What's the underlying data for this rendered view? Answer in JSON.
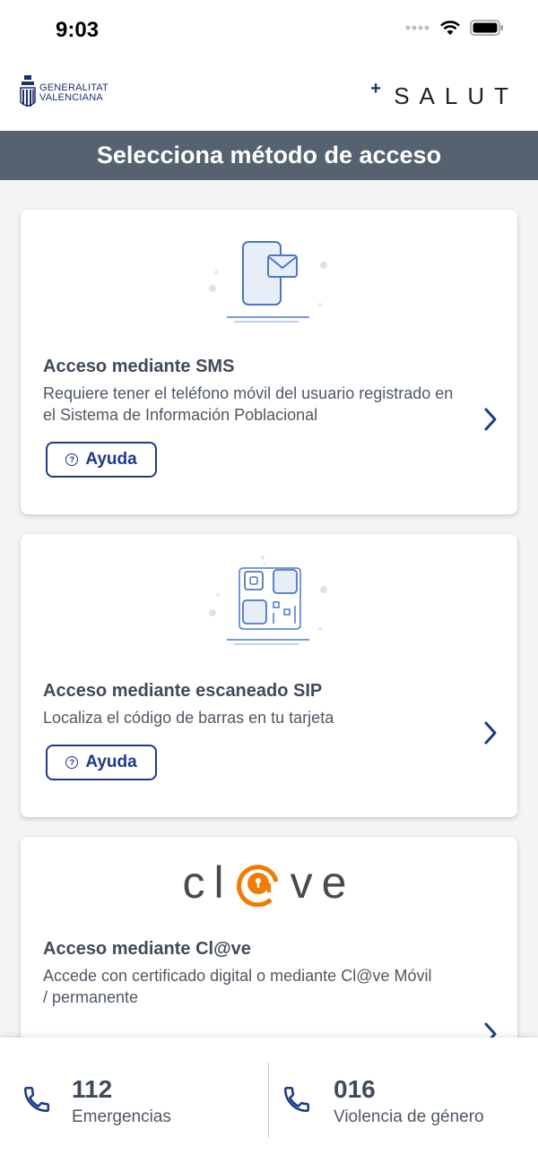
{
  "status_bar": {
    "time": "9:03"
  },
  "header": {
    "gva_logo_line1": "GENERALITAT",
    "gva_logo_line2": "VALENCIANA",
    "salut_logo": "SALUT"
  },
  "page_title": "Selecciona método de acceso",
  "methods": [
    {
      "title": "Acceso mediante SMS",
      "description": "Requiere tener el teléfono móvil del usuario registrado en el Sistema de Información Poblacional",
      "help_label": "Ayuda",
      "icon": "phone-message-icon"
    },
    {
      "title": "Acceso mediante escaneado SIP",
      "description": "Localiza el código de barras en tu tarjeta",
      "help_label": "Ayuda",
      "icon": "qr-code-icon"
    },
    {
      "title": "Acceso mediante Cl@ve",
      "description": "Accede con certificado digital o mediante Cl@ve Móvil / permanente",
      "logo_text_left": "cl",
      "logo_text_right": "ve",
      "icon": "clave-logo"
    }
  ],
  "footer": {
    "items": [
      {
        "number": "112",
        "label": "Emergencias",
        "icon": "phone-icon"
      },
      {
        "number": "016",
        "label": "Violencia de género",
        "icon": "phone-icon"
      }
    ]
  },
  "colors": {
    "title_bar": "#566270",
    "accent": "#1d3a8a",
    "clave_orange": "#f07d00",
    "illustration": "#4a78c6"
  }
}
